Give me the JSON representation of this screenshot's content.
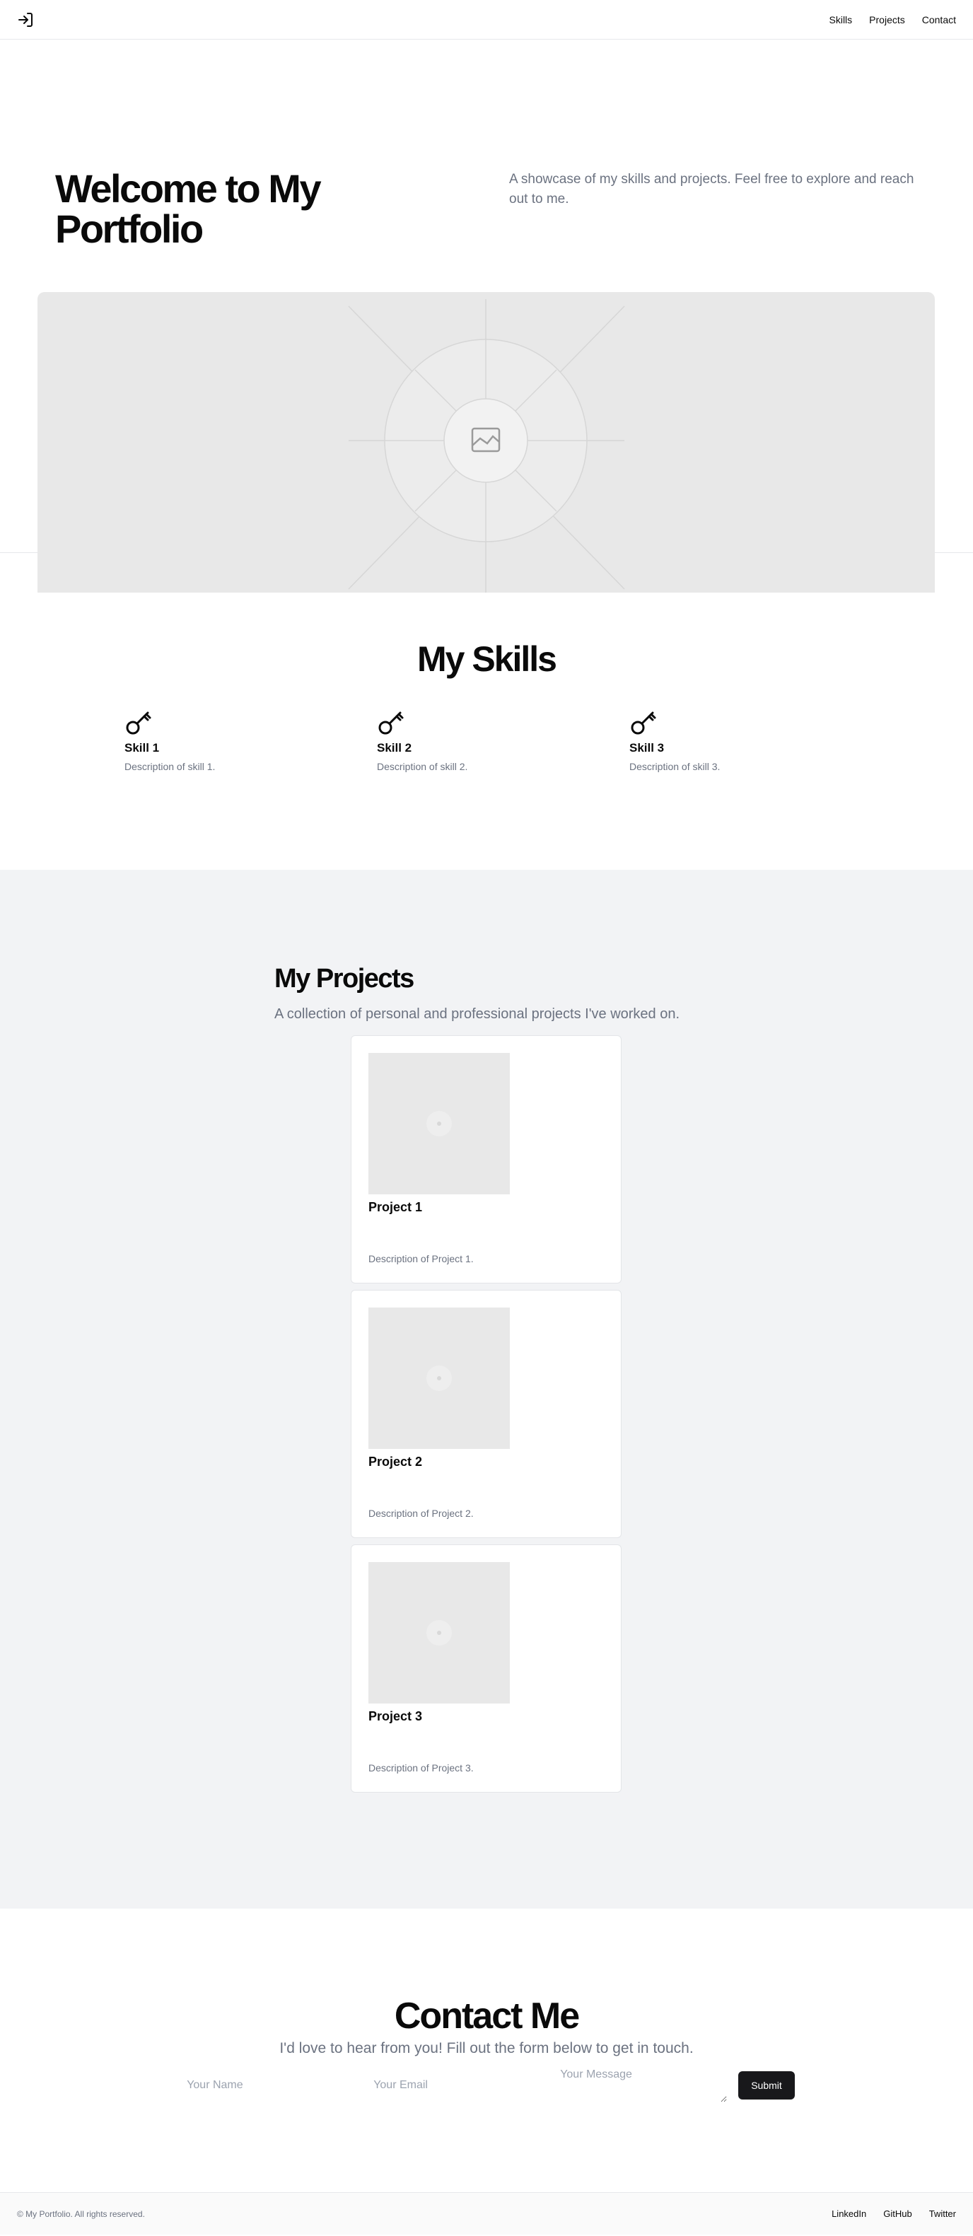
{
  "header": {
    "logo_icon": "login-arrow-icon",
    "nav": [
      {
        "label": "Skills"
      },
      {
        "label": "Projects"
      },
      {
        "label": "Contact"
      }
    ]
  },
  "hero": {
    "title": "Welcome to My Portfolio",
    "subtitle": "A showcase of my skills and projects. Feel free to explore and reach out to me.",
    "image_icon": "image-placeholder-icon"
  },
  "skills": {
    "title": "My Skills",
    "items": [
      {
        "icon": "key-icon",
        "name": "Skill 1",
        "description": "Description of skill 1."
      },
      {
        "icon": "key-icon",
        "name": "Skill 2",
        "description": "Description of skill 2."
      },
      {
        "icon": "key-icon",
        "name": "Skill 3",
        "description": "Description of skill 3."
      }
    ]
  },
  "projects": {
    "title": "My Projects",
    "subtitle": "A collection of personal and professional projects I've worked on.",
    "items": [
      {
        "name": "Project 1",
        "description": "Description of Project 1."
      },
      {
        "name": "Project 2",
        "description": "Description of Project 2."
      },
      {
        "name": "Project 3",
        "description": "Description of Project 3."
      }
    ]
  },
  "contact": {
    "title": "Contact Me",
    "subtitle": "I'd love to hear from you! Fill out the form below to get in touch.",
    "name_placeholder": "Your Name",
    "email_placeholder": "Your Email",
    "message_placeholder": "Your Message",
    "submit_label": "Submit"
  },
  "footer": {
    "copyright": "© My Portfolio. All rights reserved.",
    "links": [
      {
        "label": "LinkedIn"
      },
      {
        "label": "GitHub"
      },
      {
        "label": "Twitter"
      }
    ]
  },
  "colors": {
    "text": "#0a0a0a",
    "muted": "#6b7280",
    "button": "#18181b",
    "section_bg": "#f2f3f5",
    "placeholder_bg": "#e8e8e8"
  }
}
